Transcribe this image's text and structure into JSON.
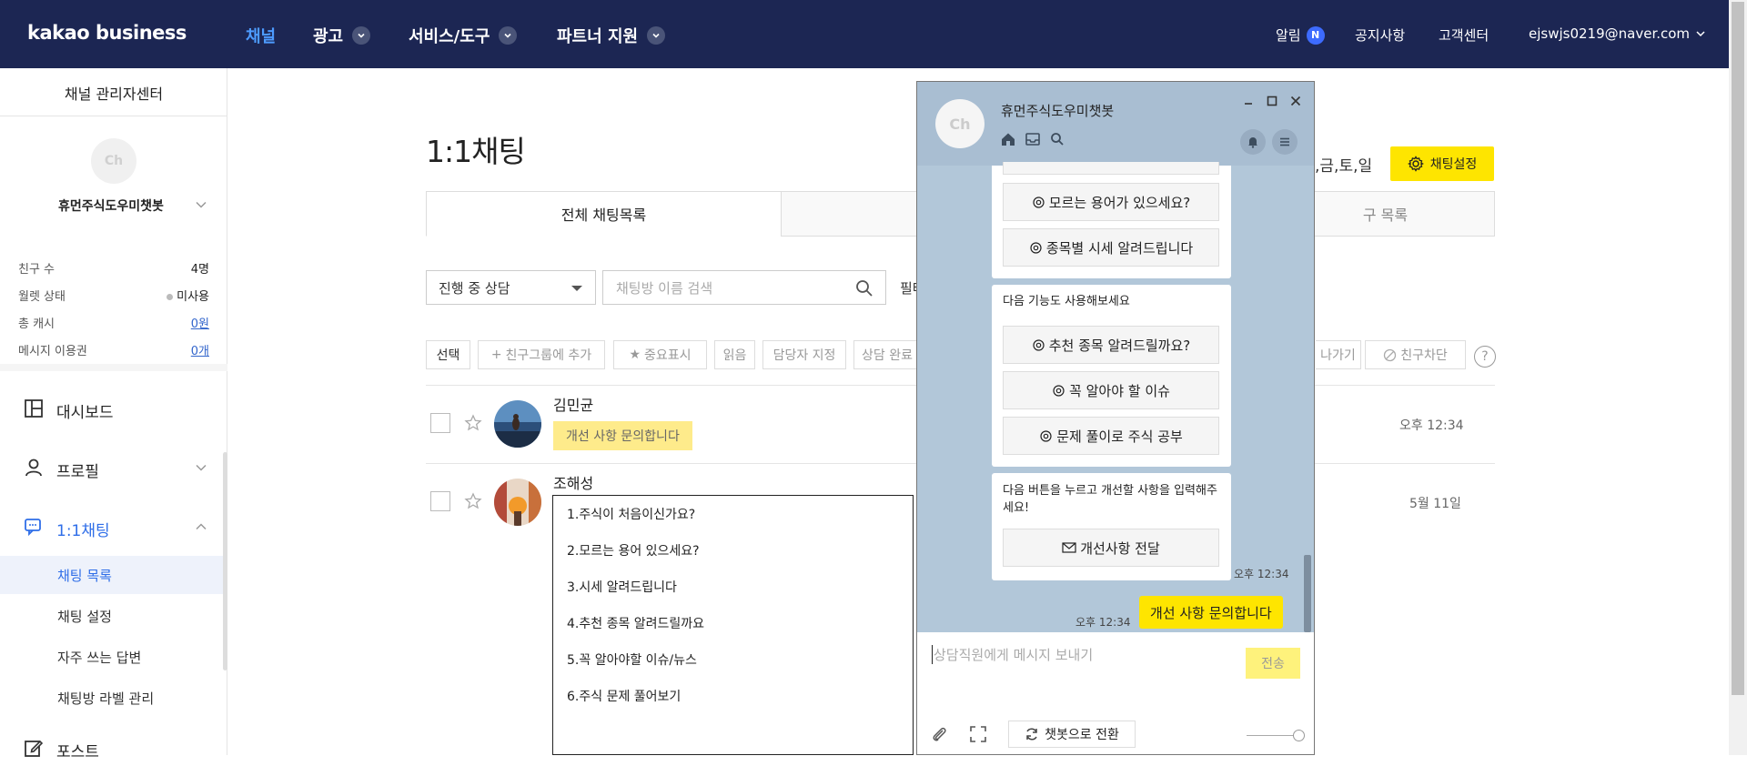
{
  "topnav": {
    "logo": "kakao business",
    "items": [
      {
        "label": "채널"
      },
      {
        "label": "광고"
      },
      {
        "label": "서비스/도구"
      },
      {
        "label": "파트너 지원"
      }
    ],
    "alert_label": "알림",
    "alert_badge": "N",
    "notice": "공지사항",
    "support": "고객센터",
    "account": "ejswjs0219@naver.com"
  },
  "sidebar": {
    "title": "채널 관리자센터",
    "avatar_text": "Ch",
    "channel_name": "휴먼주식도우미챗봇",
    "stats": [
      {
        "label": "친구 수",
        "value": "4명"
      },
      {
        "label": "월렛 상태",
        "value": "미사용"
      },
      {
        "label": "총 캐시",
        "value": "0원"
      },
      {
        "label": "메시지 이용권",
        "value": "0개"
      }
    ],
    "menu": {
      "dashboard": "대시보드",
      "profile": "프로필",
      "chat": "1:1채팅",
      "post": "포스트"
    },
    "sub": {
      "chat_list": "채팅 목록",
      "chat_settings": "채팅 설정",
      "faq": "자주 쓰는 답변",
      "labels": "채팅방 라벨 관리"
    }
  },
  "main": {
    "title": "1:1채팅",
    "days": ",금,토,일",
    "chat_setting_btn": "채팅설정",
    "tabs": {
      "all": "전체 채팅목록",
      "middle": "",
      "friends": "구 목록"
    },
    "status_select": "진행 중 상담",
    "search_placeholder": "채팅방 이름 검색",
    "filter": "필터",
    "toolbar": {
      "select": "선택",
      "add_group": "친구그룹에 추가",
      "important": "중요표시",
      "read": "읽음",
      "assign": "담당자 지정",
      "complete": "상담 완료",
      "leave": "나가기",
      "block": "친구차단",
      "help": "?"
    },
    "rows": [
      {
        "name": "김민균",
        "message": "개선 사항 문의합니다",
        "time": "오후 12:34"
      },
      {
        "name": "조해성",
        "message": "",
        "time": "5월 11일"
      }
    ]
  },
  "template_popup": {
    "items": [
      "1.주식이 처음이신가요?",
      "2.모르는 용어 있으세요?",
      "3.시세 알려드립니다",
      "4.추천 종목 알려드릴까요",
      "5.꼭 알아야할 이슈/뉴스",
      "6.주식 문제 풀어보기"
    ]
  },
  "chatwin": {
    "avatar_text": "Ch",
    "name": "휴먼주식도우미챗봇",
    "card1": {
      "buttons": [
        "모르는 용어가 있으세요?",
        "종목별 시세 알려드립니다"
      ]
    },
    "card2": {
      "text": "다음 기능도 사용해보세요",
      "buttons": [
        "추천 종목 알려드릴까요?",
        "꼭 알아야 할 이슈",
        "문제 풀이로 주식 공부"
      ]
    },
    "card3": {
      "text": "다음 버튼을 누르고 개선할 사항을 입력해주세요!",
      "button": "개선사항 전달"
    },
    "bot_time": "오후 12:34",
    "my_time": "오후 12:34",
    "my_message": "개선 사항 문의합니다",
    "input_placeholder": "상담직원에게 메시지 보내기",
    "send": "전송",
    "switch": "챗봇으로 전환"
  },
  "colors": {
    "nav_bg": "#1c2653",
    "accent_blue": "#2f6ee8",
    "kakao_yellow": "#fee500",
    "chat_bg": "#b2c7d9"
  }
}
